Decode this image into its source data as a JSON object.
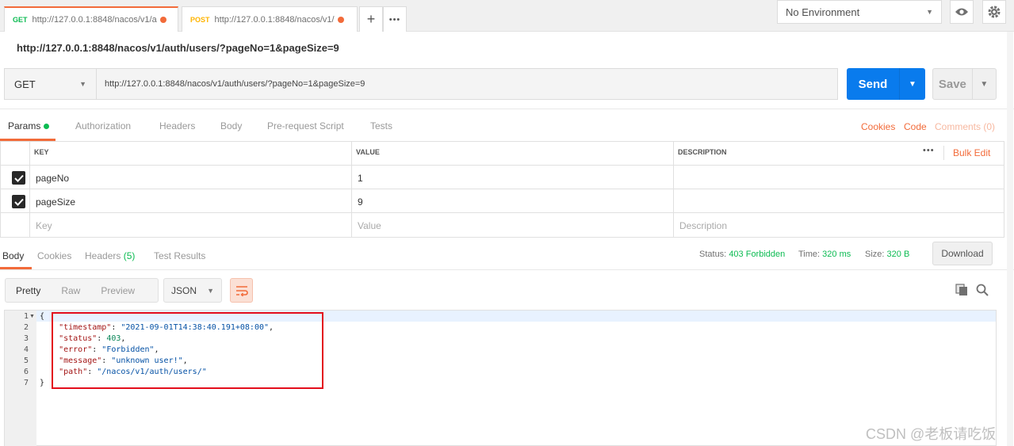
{
  "tabs": [
    {
      "method": "GET",
      "url": "http://127.0.0.1:8848/nacos/v1/a"
    },
    {
      "method": "POST",
      "url": "http://127.0.0.1:8848/nacos/v1/"
    }
  ],
  "environment": {
    "selected": "No Environment"
  },
  "request": {
    "title": "http://127.0.0.1:8848/nacos/v1/auth/users/?pageNo=1&pageSize=9",
    "method": "GET",
    "url": "http://127.0.0.1:8848/nacos/v1/auth/users/?pageNo=1&pageSize=9",
    "send_label": "Send",
    "save_label": "Save"
  },
  "request_tabs": [
    "Params",
    "Authorization",
    "Headers",
    "Body",
    "Pre-request Script",
    "Tests"
  ],
  "request_links": {
    "cookies": "Cookies",
    "code": "Code",
    "comments": "Comments (0)"
  },
  "params": {
    "headers": {
      "key": "KEY",
      "value": "VALUE",
      "description": "DESCRIPTION"
    },
    "bulk_edit": "Bulk Edit",
    "more": "•••",
    "rows": [
      {
        "key": "pageNo",
        "value": "1",
        "checked": true
      },
      {
        "key": "pageSize",
        "value": "9",
        "checked": true
      }
    ],
    "placeholders": {
      "key": "Key",
      "value": "Value",
      "description": "Description"
    }
  },
  "response_tabs": {
    "body": "Body",
    "cookies": "Cookies",
    "headers": "Headers",
    "headers_count": "(5)",
    "tests": "Test Results"
  },
  "response_status": {
    "status_label": "Status:",
    "status_value": "403 Forbidden",
    "time_label": "Time:",
    "time_value": "320 ms",
    "size_label": "Size:",
    "size_value": "320 B",
    "download_label": "Download"
  },
  "body_toolbar": {
    "pretty": "Pretty",
    "raw": "Raw",
    "preview": "Preview",
    "format": "JSON"
  },
  "code": {
    "line_numbers": [
      "1",
      "2",
      "3",
      "4",
      "5",
      "6",
      "7"
    ],
    "open": "{",
    "close": "}",
    "timestamp_key": "\"timestamp\"",
    "timestamp_value": "\"2021-09-01T14:38:40.191+08:00\"",
    "status_key": "\"status\"",
    "status_value": "403",
    "error_key": "\"error\"",
    "error_value": "\"Forbidden\"",
    "message_key": "\"message\"",
    "message_value": "\"unknown user!\"",
    "path_key": "\"path\"",
    "path_value": "\"/nacos/v1/auth/users/\""
  },
  "watermark": "CSDN @老板请吃饭",
  "colors": {
    "accent": "#f26b3a",
    "send": "#097bed",
    "success": "#0cbb52",
    "highlight_box": "#e30e1c"
  }
}
